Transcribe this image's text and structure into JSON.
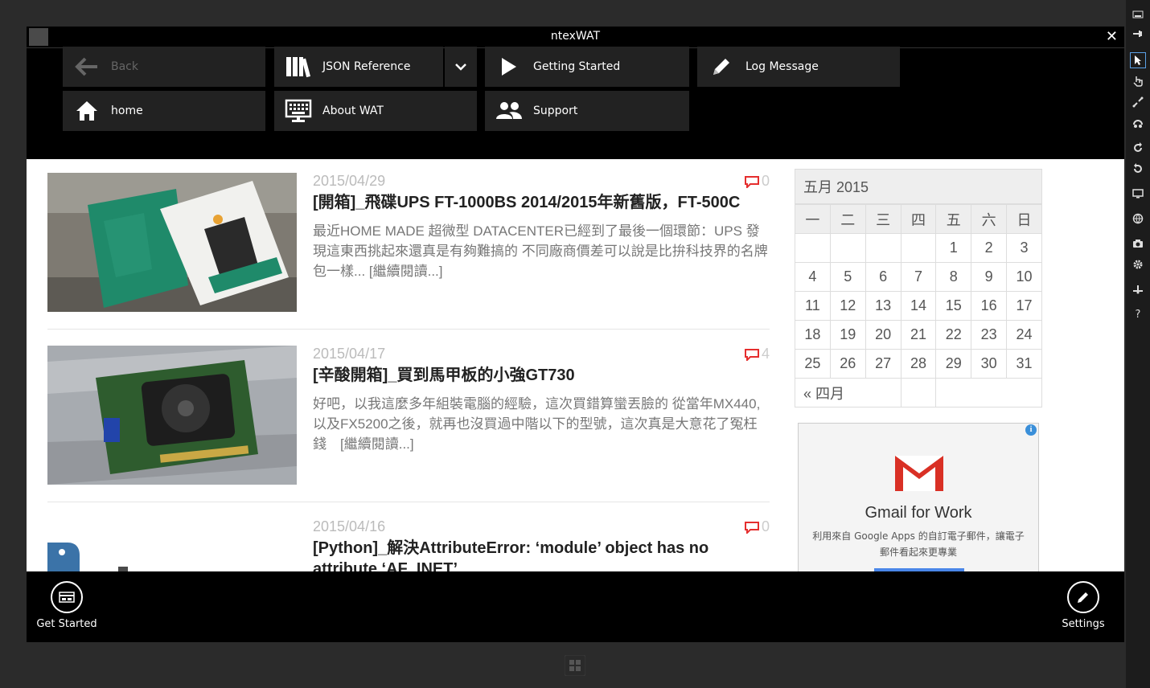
{
  "app": {
    "title": "ntexWAT",
    "close_glyph": "✕"
  },
  "nav": {
    "back": "Back",
    "json_reference": "JSON Reference",
    "getting_started": "Getting Started",
    "log_message": "Log Message",
    "home": "home",
    "about": "About WAT",
    "support": "Support"
  },
  "posts": [
    {
      "date": "2015/04/29",
      "comments": "0",
      "title": "[開箱]_飛碟UPS FT-1000BS 2014/2015年新舊版，FT-500C",
      "excerpt": "最近HOME MADE 超微型 DATACENTER已經到了最後一個環節：UPS 發現這東西挑起來還真是有夠難搞的 不同廠商價差可以說是比拚科技界的名牌包一樣... [繼續閱讀...]"
    },
    {
      "date": "2015/04/17",
      "comments": "4",
      "title": "[辛酸開箱]_買到馬甲板的小強GT730",
      "excerpt": "好吧，以我這麼多年組裝電腦的經驗，這次買錯算蠻丟臉的 從當年MX440,以及FX5200之後，就再也沒買過中階以下的型號，這次真是大意花了冤枉錢　[繼續閱讀...]"
    },
    {
      "date": "2015/04/16",
      "comments": "0",
      "title": "[Python]_解決AttributeError: ‘module’ object has no attribute ‘AF_INET’",
      "excerpt": ""
    }
  ],
  "calendar": {
    "caption": "五月 2015",
    "weekdays": [
      "一",
      "二",
      "三",
      "四",
      "五",
      "六",
      "日"
    ],
    "weeks": [
      [
        "",
        "",
        "",
        "",
        "1",
        "2",
        "3"
      ],
      [
        "4",
        "5",
        "6",
        "7",
        "8",
        "9",
        "10"
      ],
      [
        "11",
        "12",
        "13",
        "14",
        "15",
        "16",
        "17"
      ],
      [
        "18",
        "19",
        "20",
        "21",
        "22",
        "23",
        "24"
      ],
      [
        "25",
        "26",
        "27",
        "28",
        "29",
        "30",
        "31"
      ]
    ],
    "prev": "« 四月"
  },
  "ad": {
    "title": "Gmail for Work",
    "description": "利用來自 Google Apps 的自訂電子郵件，讓電子郵件看起來更專業",
    "info": "i"
  },
  "appbar": {
    "get_started": "Get Started",
    "settings": "Settings"
  },
  "toolbar": {
    "help": "?"
  },
  "colors": {
    "accent_red": "#e52e2e",
    "nav_bg": "#222222",
    "content_bg": "#ffffff"
  }
}
